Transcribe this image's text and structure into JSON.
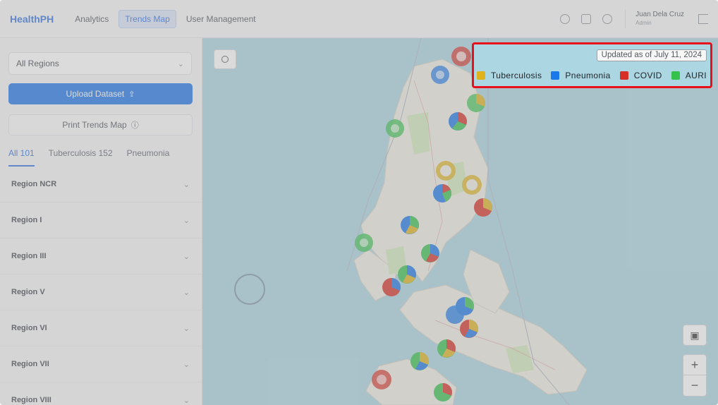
{
  "header": {
    "brand": "HealthPH",
    "nav": [
      {
        "label": "Analytics"
      },
      {
        "label": "Trends Map"
      },
      {
        "label": "User Management"
      }
    ],
    "user": {
      "name": "Juan Dela Cruz",
      "role": "Admin"
    },
    "icons": [
      "help-icon",
      "history-icon",
      "settings-icon",
      "logout-icon"
    ]
  },
  "sidebar": {
    "region_select": {
      "value": "All Regions"
    },
    "upload_label": "Upload Dataset",
    "print_label": "Print Trends Map",
    "tabs": [
      {
        "label": "All 101"
      },
      {
        "label": "Tuberculosis 152"
      },
      {
        "label": "Pneumonia"
      }
    ],
    "regions": [
      {
        "label": "Region NCR"
      },
      {
        "label": "Region I"
      },
      {
        "label": "Region III"
      },
      {
        "label": "Region V"
      },
      {
        "label": "Region VI"
      },
      {
        "label": "Region VII"
      },
      {
        "label": "Region VIII"
      }
    ]
  },
  "map": {
    "zoom_in": "+",
    "zoom_out": "−",
    "legend": {
      "updated": "Updated as of July 11, 2024",
      "items": [
        {
          "label": "Tuberculosis",
          "color": "#e0b21e"
        },
        {
          "label": "Pneumonia",
          "color": "#1a78e8"
        },
        {
          "label": "COVID",
          "color": "#d62f26"
        },
        {
          "label": "AURI",
          "color": "#35c24c"
        }
      ]
    }
  }
}
